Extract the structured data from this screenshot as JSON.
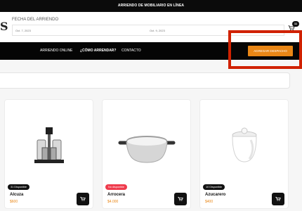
{
  "announcement": "ARRIENDO DE MOBILIARIO EN LÍNEA",
  "header": {
    "logo_text": "S",
    "date_label": "FECHA DEL ARRIENDO",
    "start_date": "Oct. 7, 2023",
    "end_date": "Oct. 9, 2023",
    "cart_count": "11"
  },
  "nav": {
    "items": [
      "ARRIENDO ONLINE",
      "¿CÓMO ARRENDAR?",
      "CONTACTO"
    ],
    "cta_label": "AGREGAR DESPACHO"
  },
  "products": [
    {
      "name": "Alcuza",
      "price": "$600",
      "availability": "31 Disponible",
      "badge_color": "#111111",
      "icon": "cruet-set-image"
    },
    {
      "name": "Arrocera",
      "price": "$4.000",
      "availability": "No disponible",
      "badge_color": "#ef3b4c",
      "icon": "cooking-pot-image"
    },
    {
      "name": "Azucarero",
      "price": "$400",
      "availability": "10 Disponible",
      "badge_color": "#111111",
      "icon": "sugar-bowl-image"
    }
  ],
  "colors": {
    "accent": "#e98616",
    "highlight": "#d02100",
    "dark": "#050505"
  }
}
